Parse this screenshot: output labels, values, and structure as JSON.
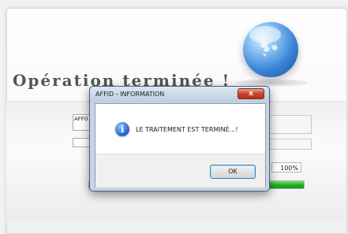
{
  "main": {
    "heading": "Opération terminée !",
    "code_field_value": "AFF0",
    "progress_percent_label": "100%",
    "progress_fraction": 1.0
  },
  "dialog": {
    "title": "AFFID - INFORMATION",
    "close_label": "x",
    "message": "LE TRAITEMENT EST TERMINÉ...!",
    "icon": "info-icon",
    "ok_label": "OK"
  },
  "colors": {
    "progress_green": "#20b020",
    "dialog_frame": "#c6d4e4",
    "close_red": "#c7432a"
  }
}
